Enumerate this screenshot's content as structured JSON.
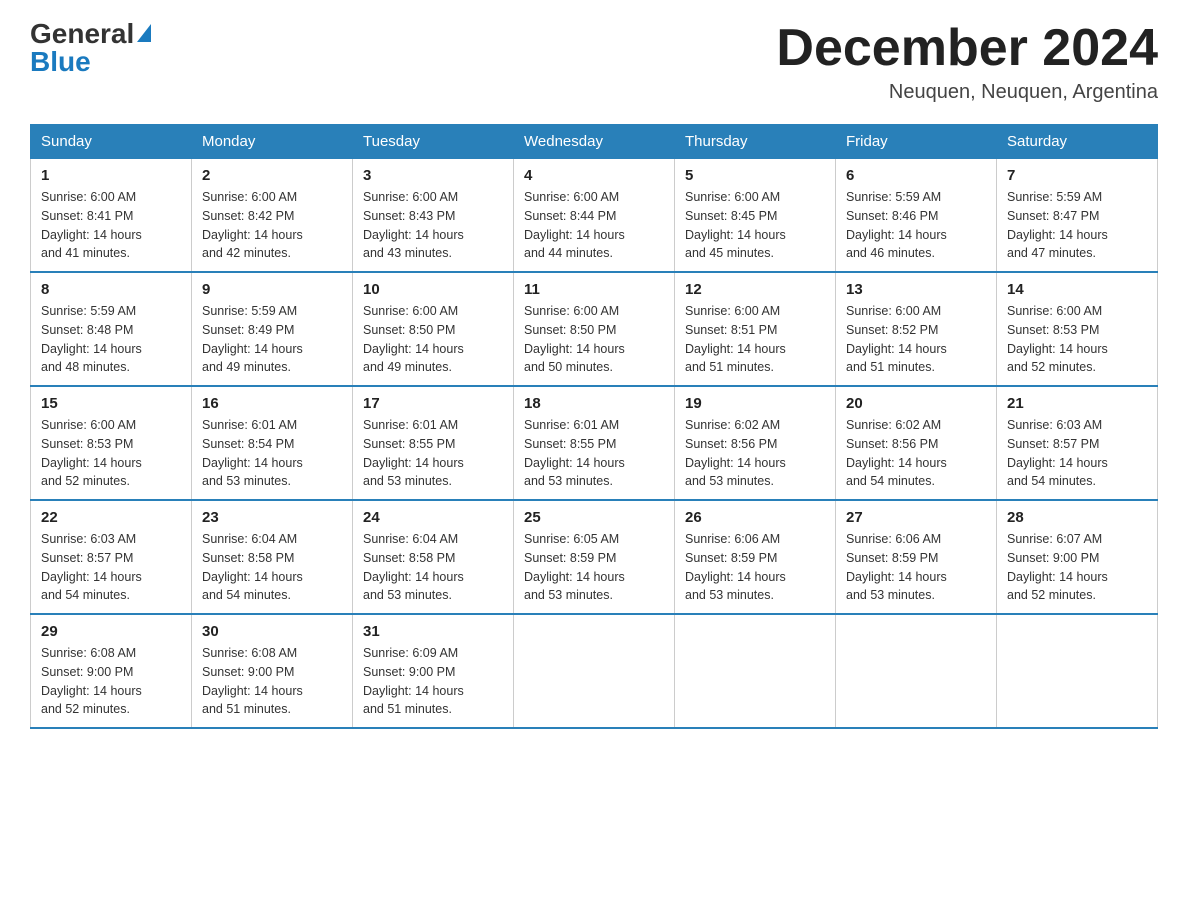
{
  "header": {
    "logo_general": "General",
    "logo_blue": "Blue",
    "title": "December 2024",
    "location": "Neuquen, Neuquen, Argentina"
  },
  "days_of_week": [
    "Sunday",
    "Monday",
    "Tuesday",
    "Wednesday",
    "Thursday",
    "Friday",
    "Saturday"
  ],
  "weeks": [
    [
      {
        "day": "1",
        "sunrise": "6:00 AM",
        "sunset": "8:41 PM",
        "daylight": "14 hours and 41 minutes."
      },
      {
        "day": "2",
        "sunrise": "6:00 AM",
        "sunset": "8:42 PM",
        "daylight": "14 hours and 42 minutes."
      },
      {
        "day": "3",
        "sunrise": "6:00 AM",
        "sunset": "8:43 PM",
        "daylight": "14 hours and 43 minutes."
      },
      {
        "day": "4",
        "sunrise": "6:00 AM",
        "sunset": "8:44 PM",
        "daylight": "14 hours and 44 minutes."
      },
      {
        "day": "5",
        "sunrise": "6:00 AM",
        "sunset": "8:45 PM",
        "daylight": "14 hours and 45 minutes."
      },
      {
        "day": "6",
        "sunrise": "5:59 AM",
        "sunset": "8:46 PM",
        "daylight": "14 hours and 46 minutes."
      },
      {
        "day": "7",
        "sunrise": "5:59 AM",
        "sunset": "8:47 PM",
        "daylight": "14 hours and 47 minutes."
      }
    ],
    [
      {
        "day": "8",
        "sunrise": "5:59 AM",
        "sunset": "8:48 PM",
        "daylight": "14 hours and 48 minutes."
      },
      {
        "day": "9",
        "sunrise": "5:59 AM",
        "sunset": "8:49 PM",
        "daylight": "14 hours and 49 minutes."
      },
      {
        "day": "10",
        "sunrise": "6:00 AM",
        "sunset": "8:50 PM",
        "daylight": "14 hours and 49 minutes."
      },
      {
        "day": "11",
        "sunrise": "6:00 AM",
        "sunset": "8:50 PM",
        "daylight": "14 hours and 50 minutes."
      },
      {
        "day": "12",
        "sunrise": "6:00 AM",
        "sunset": "8:51 PM",
        "daylight": "14 hours and 51 minutes."
      },
      {
        "day": "13",
        "sunrise": "6:00 AM",
        "sunset": "8:52 PM",
        "daylight": "14 hours and 51 minutes."
      },
      {
        "day": "14",
        "sunrise": "6:00 AM",
        "sunset": "8:53 PM",
        "daylight": "14 hours and 52 minutes."
      }
    ],
    [
      {
        "day": "15",
        "sunrise": "6:00 AM",
        "sunset": "8:53 PM",
        "daylight": "14 hours and 52 minutes."
      },
      {
        "day": "16",
        "sunrise": "6:01 AM",
        "sunset": "8:54 PM",
        "daylight": "14 hours and 53 minutes."
      },
      {
        "day": "17",
        "sunrise": "6:01 AM",
        "sunset": "8:55 PM",
        "daylight": "14 hours and 53 minutes."
      },
      {
        "day": "18",
        "sunrise": "6:01 AM",
        "sunset": "8:55 PM",
        "daylight": "14 hours and 53 minutes."
      },
      {
        "day": "19",
        "sunrise": "6:02 AM",
        "sunset": "8:56 PM",
        "daylight": "14 hours and 53 minutes."
      },
      {
        "day": "20",
        "sunrise": "6:02 AM",
        "sunset": "8:56 PM",
        "daylight": "14 hours and 54 minutes."
      },
      {
        "day": "21",
        "sunrise": "6:03 AM",
        "sunset": "8:57 PM",
        "daylight": "14 hours and 54 minutes."
      }
    ],
    [
      {
        "day": "22",
        "sunrise": "6:03 AM",
        "sunset": "8:57 PM",
        "daylight": "14 hours and 54 minutes."
      },
      {
        "day": "23",
        "sunrise": "6:04 AM",
        "sunset": "8:58 PM",
        "daylight": "14 hours and 54 minutes."
      },
      {
        "day": "24",
        "sunrise": "6:04 AM",
        "sunset": "8:58 PM",
        "daylight": "14 hours and 53 minutes."
      },
      {
        "day": "25",
        "sunrise": "6:05 AM",
        "sunset": "8:59 PM",
        "daylight": "14 hours and 53 minutes."
      },
      {
        "day": "26",
        "sunrise": "6:06 AM",
        "sunset": "8:59 PM",
        "daylight": "14 hours and 53 minutes."
      },
      {
        "day": "27",
        "sunrise": "6:06 AM",
        "sunset": "8:59 PM",
        "daylight": "14 hours and 53 minutes."
      },
      {
        "day": "28",
        "sunrise": "6:07 AM",
        "sunset": "9:00 PM",
        "daylight": "14 hours and 52 minutes."
      }
    ],
    [
      {
        "day": "29",
        "sunrise": "6:08 AM",
        "sunset": "9:00 PM",
        "daylight": "14 hours and 52 minutes."
      },
      {
        "day": "30",
        "sunrise": "6:08 AM",
        "sunset": "9:00 PM",
        "daylight": "14 hours and 51 minutes."
      },
      {
        "day": "31",
        "sunrise": "6:09 AM",
        "sunset": "9:00 PM",
        "daylight": "14 hours and 51 minutes."
      },
      null,
      null,
      null,
      null
    ]
  ],
  "labels": {
    "sunrise": "Sunrise:",
    "sunset": "Sunset:",
    "daylight": "Daylight:"
  }
}
